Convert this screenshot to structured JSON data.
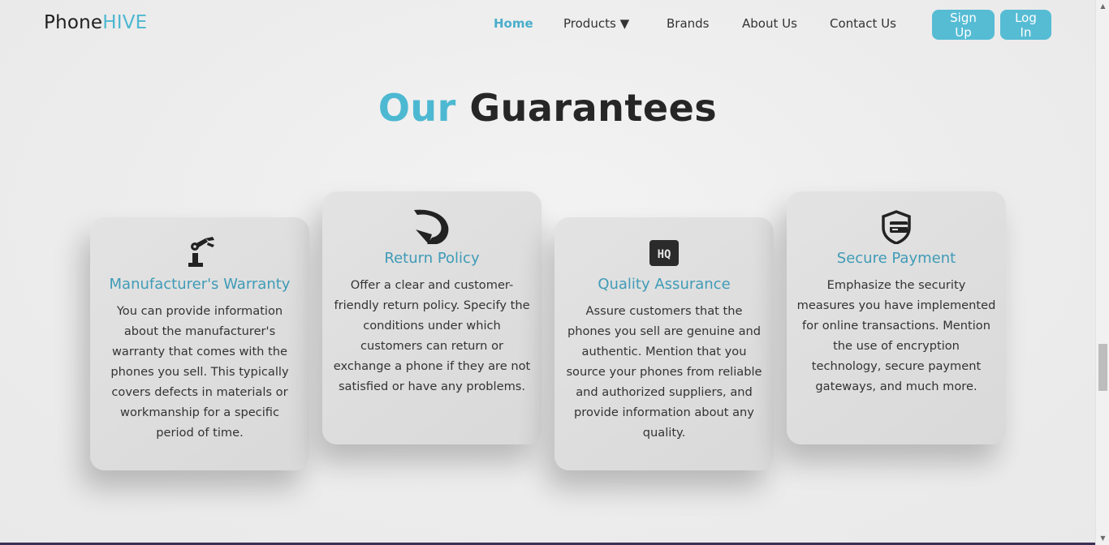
{
  "brand": {
    "part1": "Phone",
    "part2": "HIVE"
  },
  "nav": {
    "home": "Home",
    "products": "Products",
    "products_arrow": "▼",
    "brands": "Brands",
    "about": "About Us",
    "contact": "Contact Us",
    "signup": "Sign Up",
    "login": "Log In"
  },
  "section": {
    "title_accent": "Our",
    "title_rest": "Guarantees"
  },
  "cards": [
    {
      "icon": "robot-arm-icon",
      "title": "Manufacturer's Warranty",
      "text": "You can provide information about the manufacturer's warranty that comes with the phones you sell. This typically covers defects in materials or workmanship for a specific period of time."
    },
    {
      "icon": "return-arrow-icon",
      "title": "Return Policy",
      "text": "Offer a clear and customer-friendly return policy. Specify the conditions under which customers can return or exchange a phone if they are not satisfied or have any problems."
    },
    {
      "icon": "hq-badge-icon",
      "title": "Quality Assurance",
      "text": "Assure customers that the phones you sell are genuine and authentic. Mention that you source your phones from reliable and authorized suppliers, and provide information about any quality."
    },
    {
      "icon": "secure-card-shield-icon",
      "title": "Secure Payment",
      "text": "Emphasize the security measures you have implemented for online transactions. Mention the use of encryption technology, secure payment gateways, and much more."
    }
  ],
  "icons": {
    "hq_label": "HQ"
  },
  "colors": {
    "accent": "#4db8d1",
    "card_title": "#3e9bb7",
    "button": "#56bcd4"
  },
  "scrollbar": {
    "up": "▲",
    "down": "▼"
  }
}
